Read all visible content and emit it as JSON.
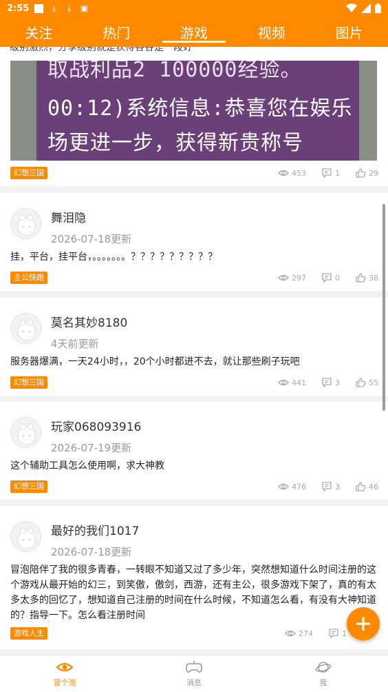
{
  "status_bar": {
    "time": "2:55"
  },
  "tabs": [
    {
      "label": "关注",
      "active": false
    },
    {
      "label": "热门",
      "active": false
    },
    {
      "label": "游戏",
      "active": true
    },
    {
      "label": "视频",
      "active": false
    },
    {
      "label": "图片",
      "active": false
    }
  ],
  "posts": [
    {
      "top_text": "级别激烈，分享级别就是获得各谷是一段好",
      "image_lines": [
        "取战利品2 100000经验。",
        "00:12)系统信息:恭喜您在娱乐",
        "场更进一步，获得新贵称号"
      ],
      "tag": "幻想三国",
      "views": "453",
      "comments": "1",
      "likes": "29"
    },
    {
      "username": "舞泪隐",
      "updated": "2026-07-18更新",
      "text": "挂，平台，挂平台，。。。。。。。？？？？？？？？？",
      "tag": "主公快跑",
      "views": "297",
      "comments": "0",
      "likes": "38"
    },
    {
      "username": "莫名其妙8180",
      "updated": "4天前更新",
      "text": "服务器爆满，一天24小时，，20个小时都进不去，就让那些刷子玩吧",
      "tag": "幻想三国",
      "views": "441",
      "comments": "3",
      "likes": "55"
    },
    {
      "username": "玩家068093916",
      "updated": "2026-07-19更新",
      "text": "这个辅助工具怎么使用啊，求大神教",
      "tag": "幻想三国",
      "views": "476",
      "comments": "3",
      "likes": "46"
    },
    {
      "username": "最好的我们1017",
      "updated": "2026-07-18更新",
      "text": "冒泡陪伴了我的很多青春，一转眼不知道又过了多少年，突然想知道什么时间注册的这个游戏从最开始的幻三，到笑傲，傲剑，西游，还有主公，很多游戏下架了，真的有太多太多的回忆了，想知道自己注册的时间在什么时候，不知道怎么看，有没有大神知道的？指导一下。怎么看注册时间",
      "tag": "游戏人生",
      "views": "274",
      "comments": "1",
      "likes": ""
    }
  ],
  "bottom_nav": [
    {
      "label": "冒个泡",
      "icon": "eye-icon",
      "active": true
    },
    {
      "label": "消息",
      "icon": "gamepad-icon",
      "active": false
    },
    {
      "label": "我",
      "icon": "planet-icon",
      "active": false
    }
  ],
  "colors": {
    "accent": "#ff8a00",
    "background": "#f2f2f2"
  }
}
